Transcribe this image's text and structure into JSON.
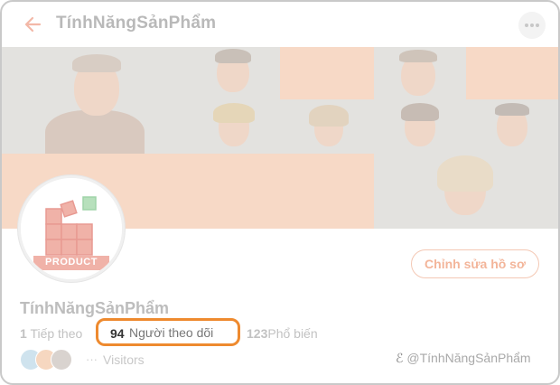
{
  "header": {
    "title": "TínhNăngSảnPhẩm"
  },
  "banner": {
    "colors": {
      "peach": "#f7d9c6",
      "gray": "#e3e2df"
    }
  },
  "avatar": {
    "logo_text": "PRODUCT"
  },
  "profile": {
    "name": "TínhNăngSảnPhẩm",
    "edit_label": "Chỉnh sửa hồ sơ"
  },
  "stats": {
    "following": {
      "count": "1",
      "label": "Tiếp theo"
    },
    "followers": {
      "count": "94",
      "label": "Người theo dõi"
    },
    "popular": {
      "count": "123",
      "label": "Phổ biến"
    }
  },
  "visitors": {
    "label": "Visitors"
  },
  "watermark": {
    "text": "@TínhNăngSảnPhẩm"
  },
  "colors": {
    "accent": "#ee8a2f",
    "edit_border": "#f4c8b4",
    "logo_red": "#e89a92",
    "logo_green": "#9fd4a8"
  }
}
